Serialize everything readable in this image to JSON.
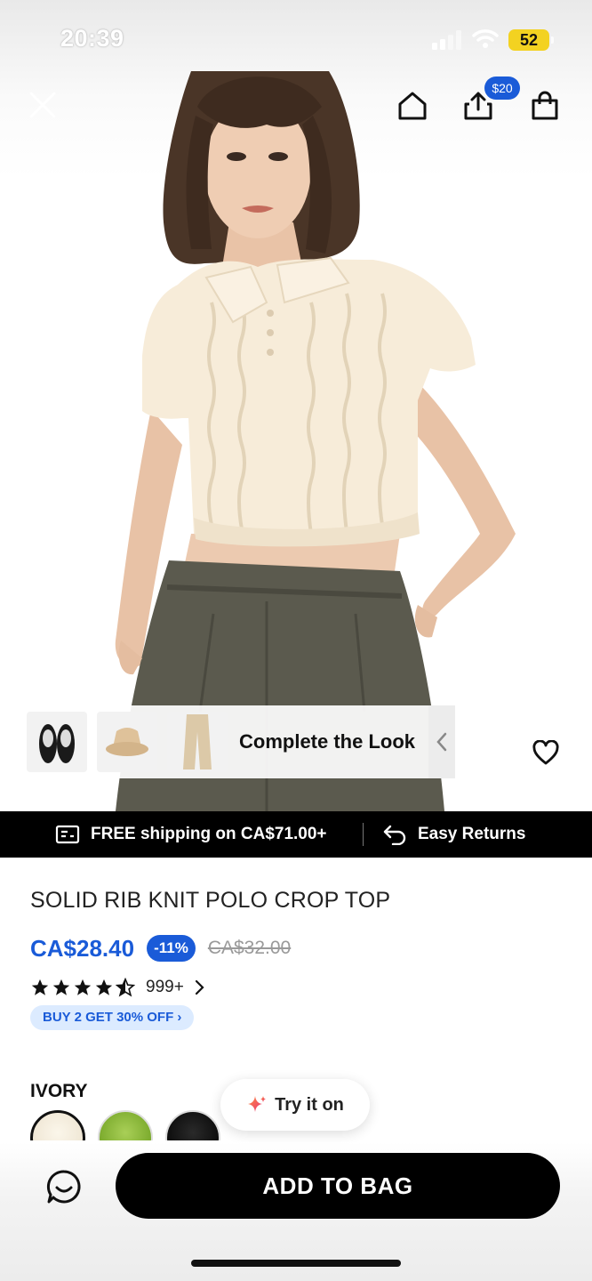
{
  "status_bar": {
    "time": "20:39",
    "battery": "52"
  },
  "header": {
    "share_badge": "$20"
  },
  "complete_look": {
    "label": "Complete the Look"
  },
  "shipping": {
    "free_shipping": "FREE shipping on CA$71.00+",
    "returns": "Easy Returns"
  },
  "product": {
    "title": "SOLID RIB KNIT POLO CROP TOP",
    "price": "CA$28.40",
    "discount": "-11%",
    "original_price": "CA$32.00",
    "rating": 4.5,
    "review_count": "999+",
    "promo": "BUY 2 GET 30% OFF ›",
    "color_label": "IVORY",
    "colors": [
      "ivory",
      "green",
      "black"
    ]
  },
  "try_on": {
    "label": "Try it on"
  },
  "cta": {
    "add_to_bag": "ADD TO BAG"
  },
  "theme": {
    "accent": "#1a5bd8",
    "promo_bg": "#dcebff",
    "banner_bg": "#000000"
  }
}
